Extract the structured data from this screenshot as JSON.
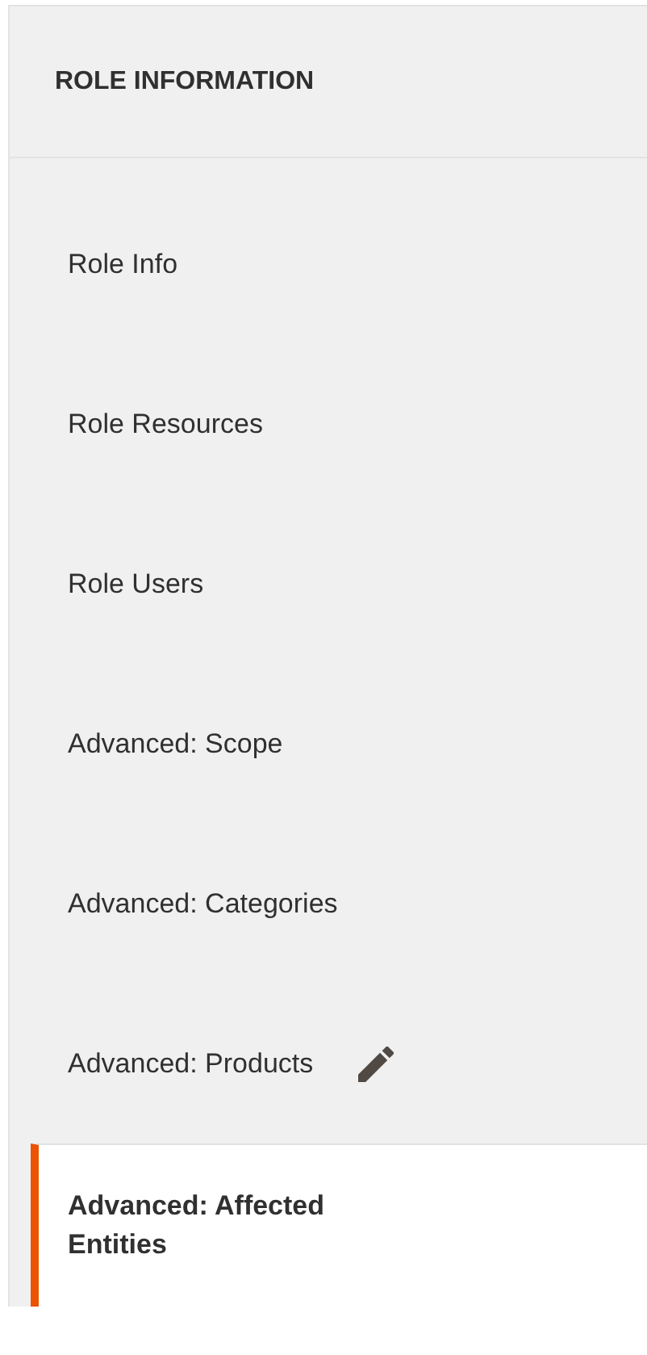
{
  "header": {
    "title": "ROLE INFORMATION"
  },
  "tabs": [
    {
      "label": "Role Info",
      "selected": false,
      "changed": false
    },
    {
      "label": "Role Resources",
      "selected": false,
      "changed": false
    },
    {
      "label": "Role Users",
      "selected": false,
      "changed": false
    },
    {
      "label": "Advanced: Scope",
      "selected": false,
      "changed": false
    },
    {
      "label": "Advanced: Categories",
      "selected": false,
      "changed": false
    },
    {
      "label": "Advanced: Products",
      "selected": false,
      "changed": true
    },
    {
      "label": "Advanced: Affected Entities",
      "selected": true,
      "changed": false
    }
  ]
}
